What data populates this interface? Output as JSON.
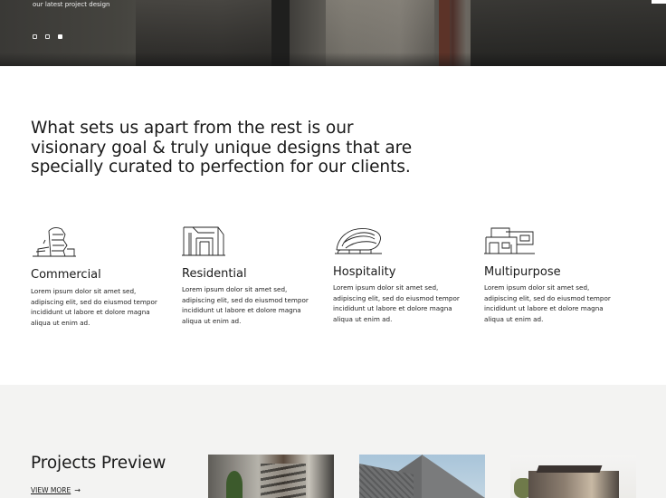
{
  "hero": {
    "caption": "our latest project design",
    "slides": [
      {
        "active": false
      },
      {
        "active": false
      },
      {
        "active": true
      }
    ]
  },
  "intro": {
    "text": "What sets us apart from the rest is our visionary goal & truly unique designs that are specially curated to perfection for our clients."
  },
  "features": [
    {
      "icon": "commercial-building-icon",
      "title": "Commercial",
      "description": "Lorem ipsum dolor sit amet sed, adipiscing elit, sed do eiusmod tempor incididunt ut labore et dolore magna aliqua ut enim ad."
    },
    {
      "icon": "residential-building-icon",
      "title": "Residential",
      "description": "Lorem ipsum dolor sit amet sed, adipiscing elit, sed do eiusmod tempor incididunt ut labore et dolore magna aliqua ut enim ad."
    },
    {
      "icon": "hospitality-building-icon",
      "title": "Hospitality",
      "description": "Lorem ipsum dolor sit amet sed, adipiscing elit, sed do eiusmod tempor incididunt ut labore et dolore magna aliqua ut enim ad."
    },
    {
      "icon": "multipurpose-building-icon",
      "title": "Multipurpose",
      "description": "Lorem ipsum dolor sit amet sed, adipiscing elit, sed do eiusmod tempor incididunt ut labore et dolore magna aliqua ut enim ad."
    }
  ],
  "projects": {
    "title": "Projects Preview",
    "view_more": "VIEW MORE",
    "arrow": "→"
  }
}
